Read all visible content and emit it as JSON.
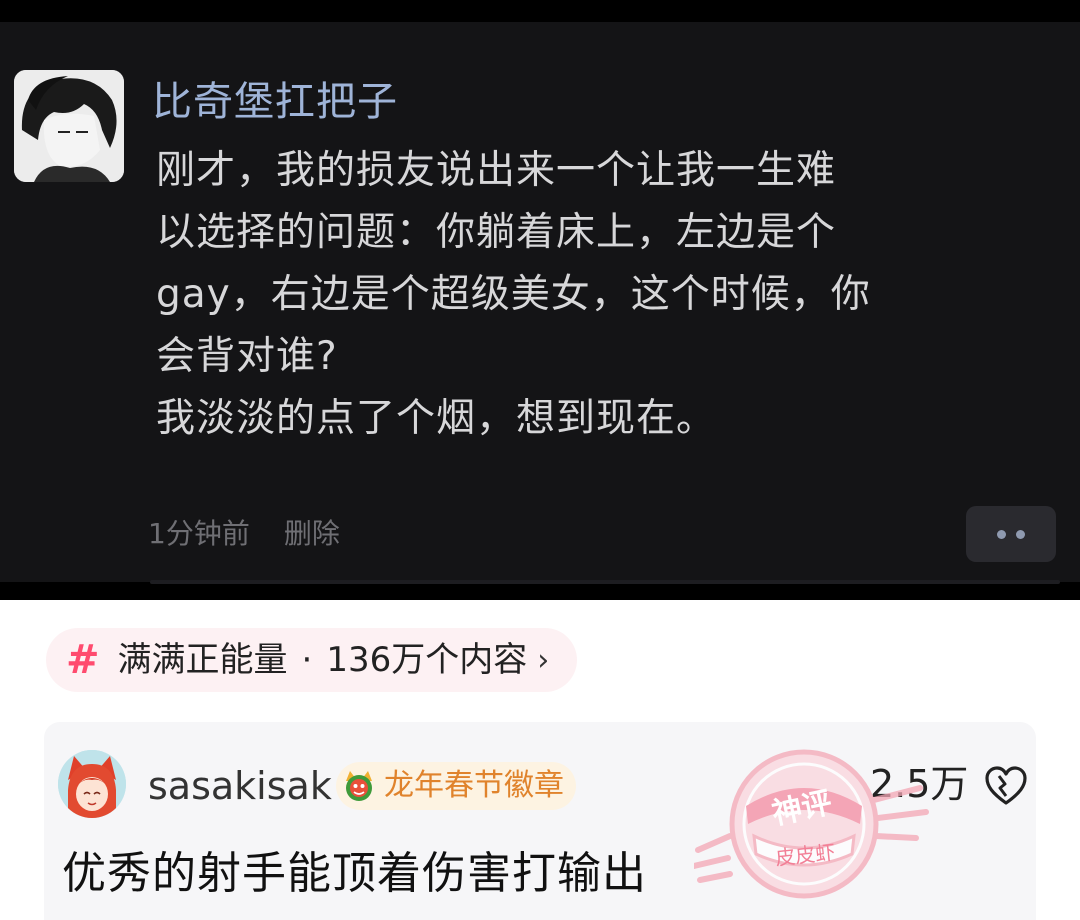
{
  "post": {
    "author": "比奇堡扛把子",
    "lines": [
      "刚才，我的损友说出来一个让我一生难",
      "以选择的问题：你躺着床上，左边是个",
      "gay，右边是个超级美女，这个时候，你",
      "会背对谁?",
      "我淡淡的点了个烟，想到现在。"
    ],
    "time": "1分钟前",
    "delete_label": "删除"
  },
  "topic": {
    "icon": "hash-icon",
    "name": "满满正能量",
    "separator": "·",
    "count": "136万个内容",
    "chevron": "›"
  },
  "comment": {
    "username": "sasakisak",
    "badge_label": "龙年春节徽章",
    "likes": "2.5万",
    "text": "优秀的射手能顶着伤害打输出",
    "stamp_top": "神评",
    "stamp_bottom": "皮皮虾"
  },
  "colors": {
    "accent": "#ff4b6e",
    "author_name": "#9fb4d8",
    "badge_text": "#e0832c",
    "stamp": "#f4a7b5"
  }
}
